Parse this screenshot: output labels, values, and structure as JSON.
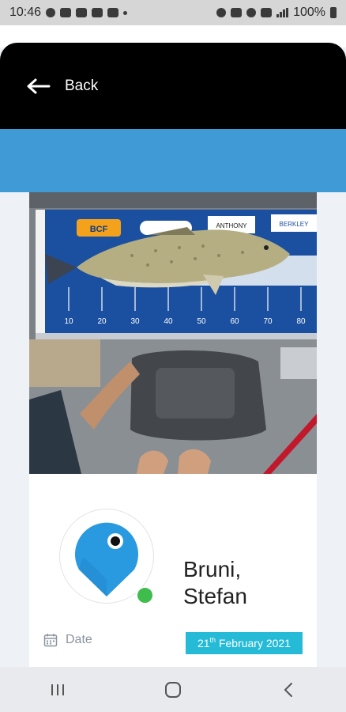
{
  "status_bar": {
    "time": "10:46",
    "battery": "100%"
  },
  "header": {
    "back_label": "Back"
  },
  "catch": {
    "angler_last": "Bruni,",
    "angler_first": "Stefan",
    "date_label": "Date",
    "date_day": "21",
    "date_suffix": "th",
    "date_rest": " February 2021"
  },
  "measure_ruler": {
    "brand_labels": [
      "BCF",
      "ANTHONY",
      "BERKLEY"
    ],
    "ticks": [
      "10",
      "20",
      "30",
      "40",
      "50",
      "60",
      "70",
      "80"
    ]
  },
  "colors": {
    "header": "#000000",
    "accent_band": "#3f9ad6",
    "date_badge": "#25bad6",
    "pin": "#2a9ae0",
    "online": "#3ebd4c"
  },
  "icons": [
    "back-arrow-icon",
    "map-pin-icon",
    "calendar-icon",
    "recent-apps-icon",
    "home-icon",
    "nav-back-icon"
  ]
}
